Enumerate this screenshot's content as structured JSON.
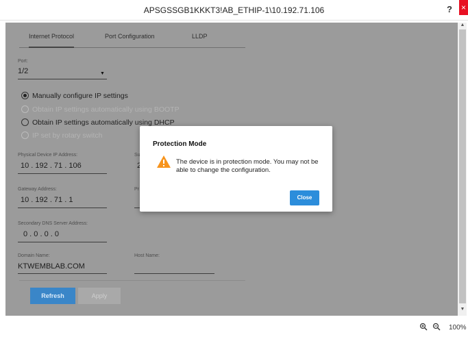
{
  "window": {
    "title": "APSGSSGB1KKKT3!AB_ETHIP-1\\10.192.71.106",
    "help_label": "?",
    "close_label": "×"
  },
  "tabs": [
    {
      "label": "Internet Protocol",
      "active": true
    },
    {
      "label": "Port Configuration",
      "active": false
    },
    {
      "label": "LLDP",
      "active": false
    }
  ],
  "port": {
    "label": "Port:",
    "value": "1/2"
  },
  "ip_options": [
    {
      "label": "Manually configure IP settings",
      "checked": true,
      "enabled": true
    },
    {
      "label": "Obtain IP settings automatically using BOOTP",
      "checked": false,
      "enabled": false
    },
    {
      "label": "Obtain IP settings automatically using DHCP",
      "checked": false,
      "enabled": true
    },
    {
      "label": "IP set by rotary switch",
      "checked": false,
      "enabled": false
    }
  ],
  "fields": {
    "ip_label": "Physical Device IP Address:",
    "ip_value": "10 . 192 . 71 . 106",
    "subnet_label_fragment": "Su",
    "subnet_value_fragment": "2",
    "gateway_label": "Gateway Address:",
    "gateway_value": "10 . 192 . 71 . 1",
    "primary_dns_label_fragment": "Pr",
    "secondary_dns_label": "Secondary DNS Server Address:",
    "secondary_dns_value": "0 . 0 . 0 . 0",
    "domain_label": "Domain Name:",
    "domain_value": "KTWEMBLAB.COM",
    "host_label": "Host Name:",
    "host_value": ""
  },
  "buttons": {
    "refresh": "Refresh",
    "apply": "Apply"
  },
  "dialog": {
    "title": "Protection Mode",
    "message": "The device is in protection mode. You may not be able to change the configuration.",
    "close": "Close",
    "icon": "warning-icon"
  },
  "status": {
    "zoom_in_icon": "zoom-in-icon",
    "zoom_out_icon": "zoom-out-icon",
    "zoom": "100%"
  },
  "colors": {
    "accent": "#3a86c8",
    "dialog_button": "#2c8ddb",
    "warning": "#f7941d",
    "close": "#e81123"
  }
}
